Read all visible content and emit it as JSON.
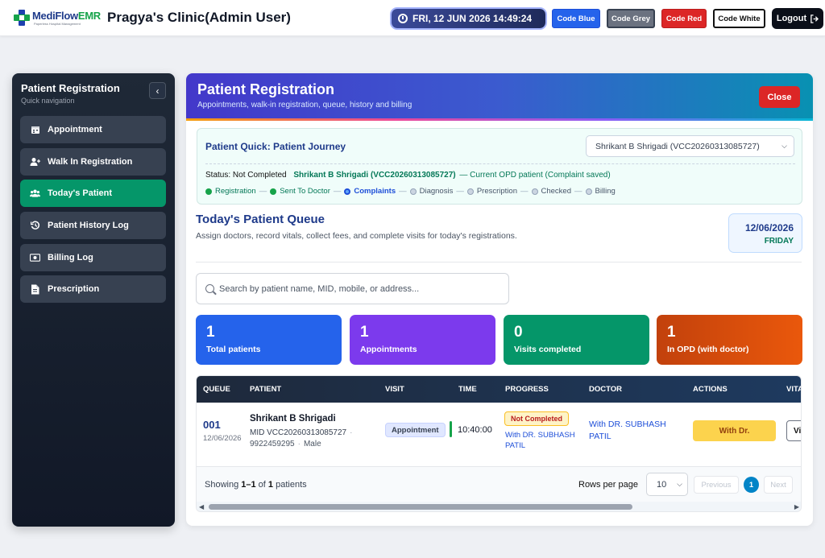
{
  "app": {
    "logo_text_a": "MediFlow",
    "logo_text_b": "EMR",
    "logo_tagline": "Paperless Hospital Management",
    "clinic_title": "Pragya's Clinic(Admin User)",
    "datetime": "FRI, 12 JUN 2026 14:49:24",
    "code_buttons": [
      "Code Blue",
      "Code Grey",
      "Code Red",
      "Code White"
    ],
    "logout_label": "Logout"
  },
  "sidebar": {
    "title": "Patient Registration",
    "subtitle": "Quick navigation",
    "collapse_glyph": "‹",
    "items": [
      {
        "label": "Appointment",
        "icon": "calendar-icon",
        "active": false
      },
      {
        "label": "Walk In Registration",
        "icon": "user-plus-icon",
        "active": false
      },
      {
        "label": "Today's Patient",
        "icon": "users-icon",
        "active": true
      },
      {
        "label": "Patient History Log",
        "icon": "history-icon",
        "active": false
      },
      {
        "label": "Billing Log",
        "icon": "money-icon",
        "active": false
      },
      {
        "label": "Prescription",
        "icon": "document-icon",
        "active": false
      }
    ]
  },
  "header": {
    "title": "Patient Registration",
    "subtitle": "Appointments, walk-in registration, queue, history and billing",
    "close_label": "Close"
  },
  "journey": {
    "title": "Patient Quick: Patient Journey",
    "selected_patient": "Shrikant B Shrigadi (VCC20260313085727)",
    "status_label": "Status: Not Completed",
    "status_patient": "Shrikant B Shrigadi (VCC20260313085727)",
    "status_note": "— Current OPD patient (Complaint saved)",
    "steps": [
      {
        "label": "Registration",
        "state": "done"
      },
      {
        "label": "Sent To Doctor",
        "state": "done"
      },
      {
        "label": "Complaints",
        "state": "current"
      },
      {
        "label": "Diagnosis",
        "state": "pending"
      },
      {
        "label": "Prescription",
        "state": "pending"
      },
      {
        "label": "Checked",
        "state": "pending"
      },
      {
        "label": "Billing",
        "state": "pending"
      }
    ]
  },
  "queue": {
    "title": "Today's Patient Queue",
    "subtitle": "Assign doctors, record vitals, collect fees, and complete visits for today's registrations.",
    "date": "12/06/2026",
    "day": "FRIDAY",
    "search_placeholder": "Search by patient name, MID, mobile, or address...",
    "stats": [
      {
        "value": "1",
        "label": "Total patients"
      },
      {
        "value": "1",
        "label": "Appointments"
      },
      {
        "value": "0",
        "label": "Visits completed"
      },
      {
        "value": "1",
        "label": "In OPD (with doctor)"
      }
    ]
  },
  "table": {
    "columns": [
      "QUEUE",
      "PATIENT",
      "VISIT",
      "TIME",
      "PROGRESS",
      "DOCTOR",
      "ACTIONS",
      "VITALS"
    ],
    "rows": [
      {
        "queue": "001",
        "date": "12/06/2026",
        "name": "Shrikant B Shrigadi",
        "mid": "MID VCC20260313085727",
        "mobile": "9922459295",
        "gender": "Male",
        "visit": "Appointment",
        "time": "10:40:00",
        "progress": "Not Completed",
        "progress_doctor": "With DR. SUBHASH PATIL",
        "doctor": "With DR. SUBHASH PATIL",
        "action": "With Dr.",
        "vitals_btn": "Vi"
      }
    ],
    "showing_prefix": "Showing ",
    "showing_range": "1–1",
    "showing_of": " of ",
    "showing_total": "1",
    "showing_suffix": " patients",
    "rows_per_page_label": "Rows per page",
    "rows_per_page": "10",
    "prev_label": "Previous",
    "page": "1",
    "next_label": "Next"
  },
  "colors": {
    "active_green": "#059669",
    "primary_blue": "#2563eb",
    "purple": "#7c3aed",
    "orange": "#ea580c",
    "danger_red": "#dc2626"
  }
}
